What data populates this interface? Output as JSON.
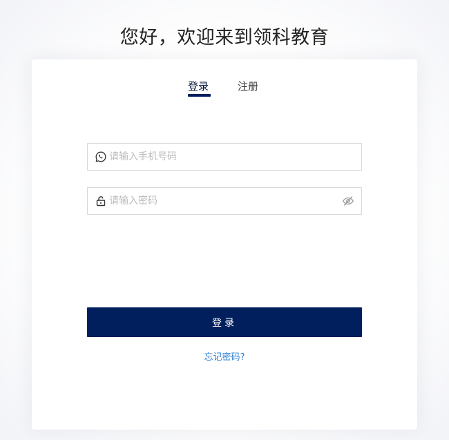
{
  "header": {
    "welcome": "您好，欢迎来到领科教育"
  },
  "tabs": [
    {
      "label": "登录",
      "active": true
    },
    {
      "label": "注册",
      "active": false
    }
  ],
  "form": {
    "phone_placeholder": "请输入手机号码",
    "phone_value": "",
    "phone_icon": "whatsapp-phone-icon",
    "password_placeholder": "请输入密码",
    "password_value": "",
    "password_icon": "lock-icon",
    "toggle_icon": "eye-hidden-icon"
  },
  "actions": {
    "login_label": "登录",
    "forgot_label": "忘记密码?"
  },
  "colors": {
    "accent": "#001f5c",
    "link": "#2e7fd1",
    "border": "#d9d9d9",
    "placeholder": "#bcbcbc"
  }
}
